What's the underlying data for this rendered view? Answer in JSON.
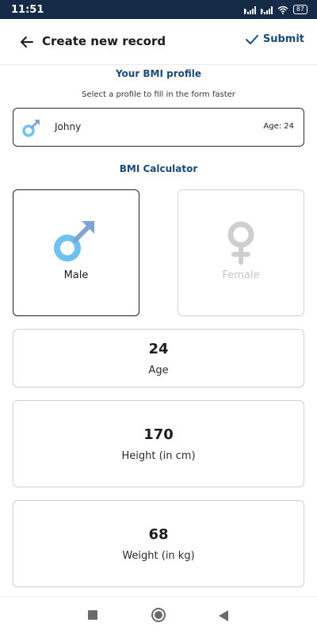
{
  "status_bar": {
    "time": "11:51",
    "battery": "87"
  },
  "header": {
    "title": "Create new record",
    "submit_label": "Submit",
    "accent": "#1a4a78"
  },
  "profile": {
    "section_title": "Your BMI profile",
    "subtitle": "Select a profile to fill in the form faster",
    "selected_name": "Johny",
    "selected_age": "Age: 24"
  },
  "calculator": {
    "section_title": "BMI Calculator",
    "genders": [
      {
        "label": "Male",
        "selected": true,
        "icon": "male-icon"
      },
      {
        "label": "Female",
        "selected": false,
        "icon": "female-icon"
      }
    ],
    "age": {
      "value": "24",
      "label": "Age"
    },
    "height": {
      "value": "170",
      "label": "Height (in cm)"
    },
    "weight": {
      "value": "68",
      "label": "Weight (in kg)"
    }
  },
  "colors": {
    "status_bar": "#152a47",
    "male_blue": "#6fc2ef",
    "male_arrow": "#7fa3d4",
    "female_grey": "#cfcfcf"
  }
}
